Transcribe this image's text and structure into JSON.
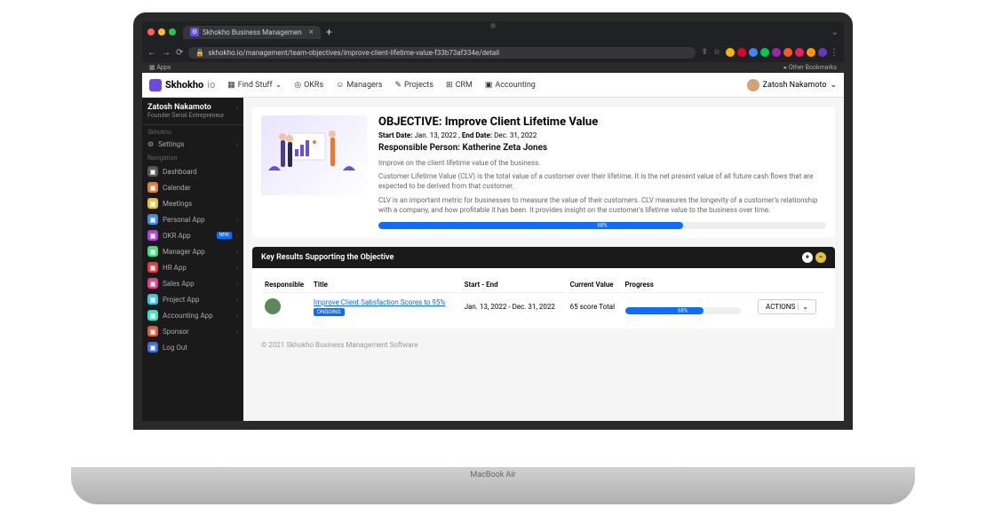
{
  "browser": {
    "tab_title": "Skhokho Business Managemen",
    "url": "skhokho.io/management/team-objectives/improve-client-lifetime-value-f33b73af334e/detail",
    "apps_label": "Apps",
    "other_bookmarks": "Other Bookmarks"
  },
  "topnav": {
    "brand": "Skhokho",
    "brand_suffix": "io",
    "items": [
      "Find Stuff",
      "OKRs",
      "Managers",
      "Projects",
      "CRM",
      "Accounting"
    ],
    "user": "Zatosh Nakamoto"
  },
  "sidebar": {
    "profile_name": "Zatosh Nakamoto",
    "profile_role": "Founder Serial Entrepreneur",
    "section1": "Skhokho",
    "settings": "Settings",
    "section2": "Navigation",
    "items": [
      {
        "label": "Dashboard",
        "color": "#555"
      },
      {
        "label": "Calendar",
        "color": "#e07b3c"
      },
      {
        "label": "Meetings",
        "color": "#e0c53c"
      },
      {
        "label": "Personal App",
        "color": "#3c8be0",
        "chev": true
      },
      {
        "label": "OKR App",
        "color": "#b03ce0",
        "badge": "NEW",
        "chev": true
      },
      {
        "label": "Manager App",
        "color": "#3ce07b",
        "chev": true
      },
      {
        "label": "HR App",
        "color": "#e03c3c",
        "chev": true
      },
      {
        "label": "Sales App",
        "color": "#e03c8b",
        "chev": true
      },
      {
        "label": "Project App",
        "color": "#3cc5e0",
        "chev": true
      },
      {
        "label": "Accounting App",
        "color": "#3ce0c5",
        "chev": true
      },
      {
        "label": "Sponsor",
        "color": "#e0583c",
        "chev": true
      },
      {
        "label": "Log Out",
        "color": "#3c6be0"
      }
    ]
  },
  "objective": {
    "title_prefix": "OBJECTIVE:",
    "title": "Improve Client Lifetime Value",
    "start_label": "Start Date:",
    "start_date": "Jan. 13, 2022",
    "end_label": "End Date:",
    "end_date": "Dec. 31, 2022",
    "person_label": "Responsible Person:",
    "person": "Katherine Zeta Jones",
    "desc1": "Improve on the client lifetime value of the business.",
    "desc2": "Customer Lifetime Value (CLV) is the total value of a customer over their lifetime. It is the net present value of all future cash flows that are expected to be derived from that customer.",
    "desc3": "CLV is an important metric for businesses to measure the value of their customers. CLV measures the longevity of a customer's relationship with a company, and how profitable it has been. It provides insight on the customer's lifetime value to the business over time.",
    "progress": 68,
    "progress_label": "68%"
  },
  "kr": {
    "header": "Key Results Supporting the Objective",
    "cols": [
      "Responsible",
      "Title",
      "Start - End",
      "Current Value",
      "Progress",
      ""
    ],
    "row": {
      "title": "Improve Client Satisfaction Scores to 95%",
      "status": "ONGOING",
      "dates": "Jan. 13, 2022 - Dec. 31, 2022",
      "value": "65 score Total",
      "progress": 68,
      "progress_label": "68%",
      "actions": "ACTIONS"
    }
  },
  "footer": "© 2021 Skhokho Business Management Software",
  "base": "MacBook Air"
}
